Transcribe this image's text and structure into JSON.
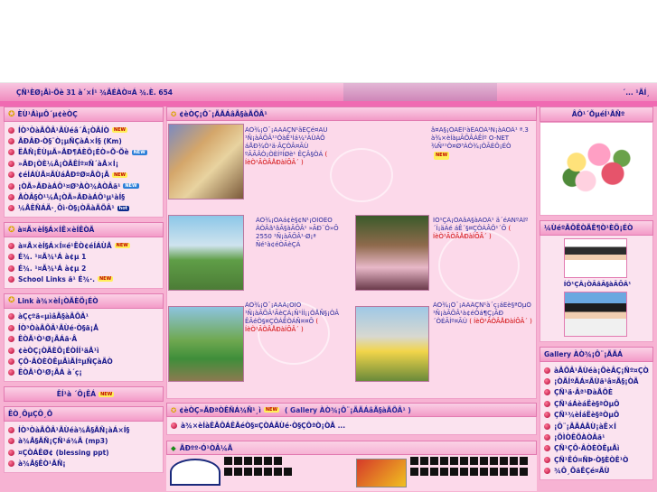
{
  "statusbar": {
    "left": "ÇÑ¹ÈØ¡Ãì·Õè 31 à´×Í¹ ¾ÄÉÀÒ¤Á ¾.È. 654",
    "right": "´... ¹ÃÍ¸"
  },
  "left": {
    "menu1": {
      "title": "ÈÙ¹ÂìµÔ´µ¢èÒÇ",
      "items": [
        {
          "label": "ÍÒ³ÒàÃÕÂ¹ÃÙéâ´Â¡ÒÃÍÒ",
          "badge": "NEW",
          "badge_style": "new"
        },
        {
          "label": "ÃÐÂÐ·Ò§¨Ò¡µÑÇàÁ×Í§ (Km)",
          "badge": "",
          "badge_style": ""
        },
        {
          "label": "ËÅÑ¡ÊÙµÃ»ÃÐ¶ÁÈÖ¡ÉÒ»Õ·Õè",
          "badge": "NEW",
          "badge_style": "new2"
        },
        {
          "label": "»ÃÐ¡ÒÈ¼Å¡ÒÃÊÍº¤Ñ´àÅ×Í¡",
          "badge": "",
          "badge_style": ""
        },
        {
          "label": "¢éÍÁÙÅ¤ÃÙáÅÐºØ¤ÅÒ¡Ã",
          "badge": "NEW",
          "badge_style": "new"
        },
        {
          "label": "¡ÒÃ»ÃÐàÁÔ¹¤Ø³ÀÒ¾ÀÒÂã¹",
          "badge": "NEW",
          "badge_style": "new2"
        },
        {
          "label": "ÃÒÂ§Ò¹¼Å¡ÒÃ»ÃÐàÁÔ¹µ¹àÍ§",
          "badge": "",
          "badge_style": ""
        },
        {
          "label": "¼ÅÊÑÁÄ·¸Ôì·Ò§¡ÒÃàÃÕÂ¹",
          "badge": "hot",
          "badge_style": "hot"
        }
      ]
    },
    "menu2": {
      "title": "à¤Ã×èÍ§Á×ÍÊ×èÍÊÒÃ",
      "items": [
        {
          "label": "à¤Ã×èÍ§Á×Í¤é¹ËÒ¢éÍÁÙÅ",
          "badge": "NEW",
          "badge_style": "new"
        },
        {
          "label": "É¾. ¹¤Ã¾¹Á à¢µ 1",
          "badge": "",
          "badge_style": ""
        },
        {
          "label": "É¾. ¹¤Ã¾¹Á à¢µ 2",
          "badge": "",
          "badge_style": ""
        },
        {
          "label": "School Links ã¹ É¾·.",
          "badge": "NEW",
          "badge_style": "new"
        }
      ]
    },
    "menu3": {
      "title": "Link à¾×èÍ¡ÒÃÈÖ¡ÉÒ",
      "items": [
        {
          "label": "àÇçºä«µìâÃ§àÃÕÂ¹",
          "badge": "",
          "badge_style": ""
        },
        {
          "label": "ÍÒ³ÒàÃÕÂ¹ÃÙé·Ò§ä¡Å",
          "badge": "",
          "badge_style": ""
        },
        {
          "label": "ÊÒÃ¹Ò¹Ø¡ÃÁä·Â",
          "badge": "",
          "badge_style": ""
        },
        {
          "label": "¢èÒÇ¡ÒÃÈÖ¡ÉÒÍÍ¹äÅ¹ì",
          "badge": "",
          "badge_style": ""
        },
        {
          "label": "ÇÔ·ÂÒÈÒÊµÃìÃÍºµÑÇàÃÒ",
          "badge": "",
          "badge_style": ""
        },
        {
          "label": "ÊÒÃ¹Ò¹Ø¡ÃÁ à´ç¡",
          "badge": "",
          "badge_style": ""
        }
      ]
    },
    "menu4": {
      "title": "ÊÍ¹à ´Ô¡ÊÁ",
      "badge": "NEW"
    },
    "menu5": {
      "title": "ÊÒ¸ÔµÇÔ¸Õ",
      "items": [
        {
          "label": "ÍÒ³ÒàÃÕÂ¹ÃÙéà¾Å§ÃÑ¡àÁ×Í§",
          "badge": "",
          "badge_style": ""
        },
        {
          "label": "à¾Å§ÃÑ¡ÇÑ¹á¾Ã (mp3)",
          "badge": "",
          "badge_style": ""
        },
        {
          "label": "¤ÇÒÁÊØ¢ (blessing ppt)",
          "badge": "",
          "badge_style": ""
        },
        {
          "label": "à¾Å§ÊÒ¹ÃÑ¡",
          "badge": "",
          "badge_style": ""
        }
      ]
    }
  },
  "middle": {
    "news_title": "¢èÒÇ¡Ô¨¡ÃÃÁâÃ§àÃÕÂ¹",
    "news": [
      {
        "text": "ÀÒ¾¡Ô¨¡ÃÃÁÇÑ¹äËÇé¤ÃÙ ¹Ñ¡àÃÕÂ¹¹ÓàÊ¹Íá¼¹ÀÙÁÔ áÅÐ¾Ò¹ä·ÂÇÒÂ¤ÃÙ ºÃÃÂÒ¡ÒÈÍºÍØè¹ ÊÇÂ§ÒÁ",
        "more": "( ÍèÒ¹ÃÒÂÅÐàÍÕÂ´ )"
      },
      {
        "text": "â¤Ã§¡ÒÃÊÍ¹àÊÃÔÁ¹Ñ¡àÃÕÂ¹ ª.3 à¾×èÍàµÃÕÂÁÊÍº O-NET ¾Ñ²¹Ò¤Ø³ÀÒ¾¡ÒÃÈÖ¡ÉÒ",
        "more": "( ÍèÒ¹ÃÒÂÅÐàÍÕÂ´ )"
      },
      {
        "text": "ÀÒ¾¡ÒÃá¢è§¢Ñ¹¡ÕÌÒÊÕ ÀÒÂã¹âÃ§àÃÕÂ¹ »ÃÐ¨Ó»Õ 2550 ¹Ñ¡àÃÕÂ¹·Ø¡ª Ñé¹à¢éÒÃèÇÁ",
        "more": ""
      },
      {
        "text": "ÍÓ¹ÇÂ¡ÒÃâÃ§àÃÕÂ¹ ä´éÃÑºÁÍº´Í¡äÁé áÊ´§¤ÇÒÁÂÔ¹´Õ",
        "more": "( ÍèÒ¹ÃÒÂÅÐàÍÕÂ´ )"
      },
      {
        "text": "ÀÒ¾¡Ô¨¡ÃÃÁ¡ÕÌÒ ¹Ñ¡àÃÕÂ¹ÃèÇÁ¡Ñ¹ÍÍ¡¡ÓÅÑ§¡ÒÂ ÊÃéÒ§¤ÇÒÁÊÒÁÑ¤¤Õ",
        "more": "( ÍèÒ¹ÃÒÂÅÐàÍÕÂ´ )"
      },
      {
        "text": "ÀÒ¾¡Ô¨¡ÃÃÁÇÑ¹à´ç¡áËè§ªÒµÔ ¹Ñ¡àÃÕÂ¹à¢éÒá¶Ç¡ÃÐ´ÒÉÃÍº¤ÃÙ",
        "more": "( ÍèÒ¹ÃÒÂÅÐàÍÕÂ´ )"
      }
    ],
    "gallery_title": "¢èÒÇ»ÃÐªÒÊÑÁ¾Ñ¹¸ì",
    "gallery_link": "( Gallery ÀÒ¾¡Ô¨¡ÃÃÁâÃ§àÃÕÂ¹ )",
    "gallery_line": "à¾×èÍàÊÃÔÁÊÃéÒ§¤ÇÒÁÃÙé·Ò§ÇÔªÒ¡ÒÃ ...",
    "bottom_title": "ÃÐºº·Ó¹ÒÂ¼Å"
  },
  "right": {
    "greet_title": "ÂÔ¹´ÕµéÍ¹ÃÑº",
    "director_title": "¼ÙéºÃÔËÒÃÊ¶Ò¹ÈÖ¡ÉÒ",
    "director_name": "ÍÓ¹ÇÂ¡ÒÃâÃ§àÃÕÂ¹",
    "gallery_title": "Gallery ÀÒ¾¡Ô¨¡ÃÃÁ",
    "gallery_items": [
      {
        "label": "àÃÕÂ¹ÃÙéà¡ÕèÂÇ¡Ñº¤ÇÒÁ»ÅÍ´ÀÑÂ",
        "badge": "NEW"
      },
      {
        "label": "¡ÒÃÍºÃÁ¤ÃÙã¹â¤Ã§¡ÒÃ",
        "badge": ""
      },
      {
        "label": "ÇÑ¹ä·Âª¹ÐàÅÔÈ",
        "badge": ""
      },
      {
        "label": "ÇÑ¹áÁèáËè§ªÒµÔ",
        "badge": ""
      },
      {
        "label": "ÇÑ¹¾èÍáËè§ªÒµÔ",
        "badge": ""
      },
      {
        "label": "¡Ô¨¡ÃÃÁÅÙ¡àÊ×Í",
        "badge": ""
      },
      {
        "label": "¡ÕÌÒÊÕÀÒÂã¹",
        "badge": ""
      },
      {
        "label": "ÇÑ¹ÇÔ·ÂÒÈÒÊµÃì",
        "badge": ""
      },
      {
        "label": "ÇÑ¹ÊÓ¤ÑÞ·Ò§ÈÒÊ¹Ò",
        "badge": ""
      },
      {
        "label": "¾Ô¸ÕäËÇé¤ÃÙ",
        "badge": ""
      }
    ]
  }
}
